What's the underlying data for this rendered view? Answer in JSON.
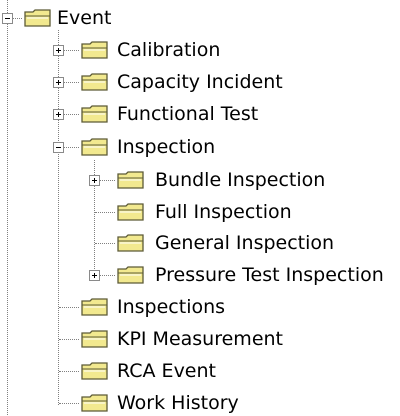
{
  "tree": {
    "root": {
      "label": "Event",
      "expanded": true
    },
    "items": [
      {
        "label": "Calibration",
        "expander": "plus"
      },
      {
        "label": "Capacity Incident",
        "expander": "plus"
      },
      {
        "label": "Functional Test",
        "expander": "plus"
      },
      {
        "label": "Inspection",
        "expander": "minus",
        "children": [
          {
            "label": "Bundle Inspection",
            "expander": "plus"
          },
          {
            "label": "Full Inspection",
            "expander": "none"
          },
          {
            "label": "General Inspection",
            "expander": "none"
          },
          {
            "label": "Pressure Test Inspection",
            "expander": "plus"
          }
        ]
      },
      {
        "label": "Inspections",
        "expander": "none"
      },
      {
        "label": "KPI Measurement",
        "expander": "none"
      },
      {
        "label": "RCA Event",
        "expander": "none"
      },
      {
        "label": "Work History",
        "expander": "none"
      }
    ],
    "icons": {
      "node": "folder-icon",
      "expand": "plus-box-icon",
      "collapse": "minus-box-icon"
    },
    "colors": {
      "folder_fill": "#f2e98f",
      "folder_edge": "#5c5a36",
      "guide": "#808080"
    }
  }
}
